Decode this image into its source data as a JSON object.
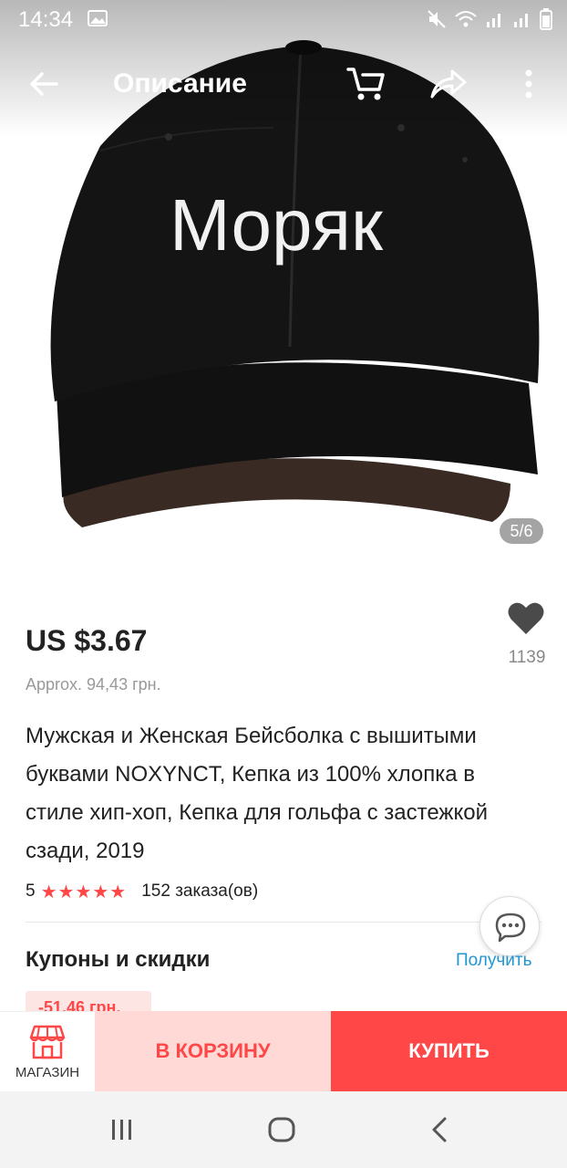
{
  "status_bar": {
    "time": "14:34"
  },
  "header": {
    "title": "Описание"
  },
  "gallery": {
    "counter": "5/6",
    "cap_text": "Моряк"
  },
  "product": {
    "price": "US $3.67",
    "approx_price": "Approx. 94,43 грн.",
    "wishlist_count": "1139",
    "title": "Мужская и Женская Бейсболка с вышитыми буквами NOXYNCT, Кепка из 100% хлопка в стиле хип-хоп, Кепка для гольфа с застежкой сзади, 2019",
    "rating": "5",
    "stars": "★★★★★",
    "orders": "152 заказа(ов)"
  },
  "coupons": {
    "title": "Купоны и скидки",
    "get_label": "Получить",
    "chip_text": "-51,46 грн."
  },
  "actions": {
    "store_label": "МАГАЗИН",
    "add_to_cart": "В КОРЗИНУ",
    "buy": "КУПИТЬ"
  },
  "colors": {
    "accent": "#ff4747",
    "cart_bg": "#ffd9d6",
    "link": "#2196d3"
  },
  "icons": {
    "back": "arrow-left-icon",
    "cart": "cart-icon",
    "share": "share-icon",
    "more": "more-vertical-icon",
    "wishlist": "heart-icon",
    "chat": "chat-bubble-icon",
    "store": "store-icon"
  }
}
